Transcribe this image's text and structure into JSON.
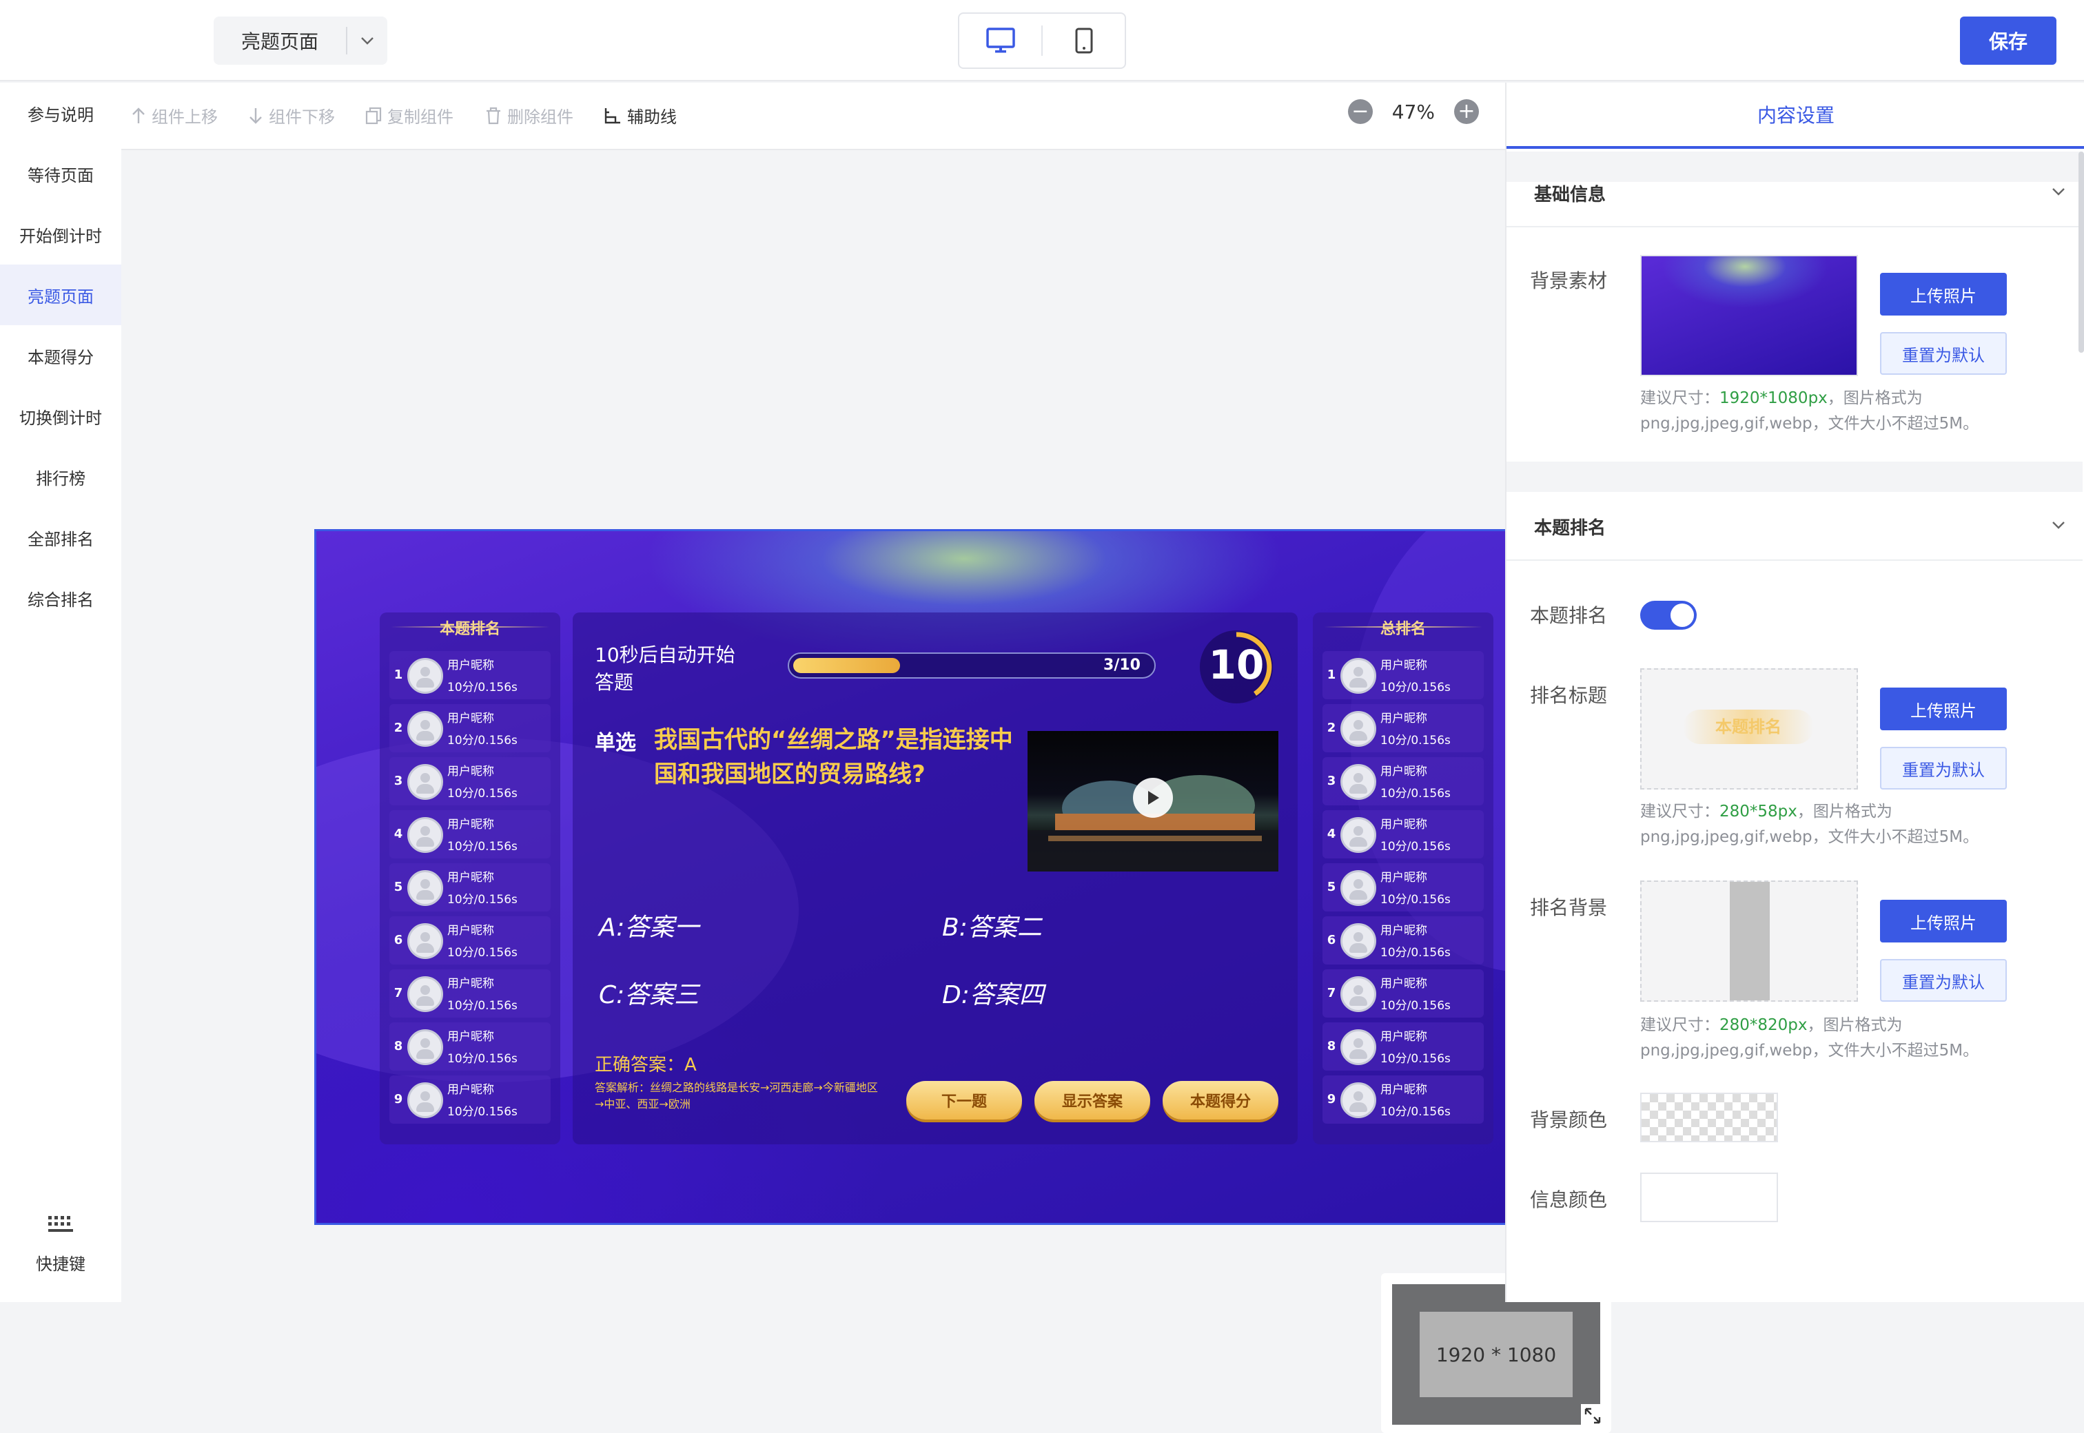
{
  "header": {
    "page_selector": "亮题页面",
    "save_label": "保存"
  },
  "sidebar": {
    "items": [
      {
        "label": "参与说明"
      },
      {
        "label": "等待页面"
      },
      {
        "label": "开始倒计时"
      },
      {
        "label": "亮题页面",
        "active": true
      },
      {
        "label": "本题得分"
      },
      {
        "label": "切换倒计时"
      },
      {
        "label": "排行榜"
      },
      {
        "label": "全部排名"
      },
      {
        "label": "综合排名"
      }
    ],
    "shortcut_label": "快捷键"
  },
  "toolbar": {
    "move_up": "组件上移",
    "move_down": "组件下移",
    "copy": "复制组件",
    "delete": "删除组件",
    "guides": "辅助线",
    "zoom": "47%"
  },
  "stage": {
    "left_rank_title": "本题排名",
    "right_rank_title": "总排名",
    "rank_rows": [
      {
        "num": "1",
        "name": "用户昵称",
        "score": "10分/0.156s"
      },
      {
        "num": "2",
        "name": "用户昵称",
        "score": "10分/0.156s"
      },
      {
        "num": "3",
        "name": "用户昵称",
        "score": "10分/0.156s"
      },
      {
        "num": "4",
        "name": "用户昵称",
        "score": "10分/0.156s"
      },
      {
        "num": "5",
        "name": "用户昵称",
        "score": "10分/0.156s"
      },
      {
        "num": "6",
        "name": "用户昵称",
        "score": "10分/0.156s"
      },
      {
        "num": "7",
        "name": "用户昵称",
        "score": "10分/0.156s"
      },
      {
        "num": "8",
        "name": "用户昵称",
        "score": "10分/0.156s"
      },
      {
        "num": "9",
        "name": "用户昵称",
        "score": "10分/0.156s"
      }
    ],
    "tip": "10秒后自动开始答题",
    "progress_label": "3/10",
    "progress_fraction": 0.3,
    "timer": "10",
    "question_type": "单选",
    "question": "我国古代的“丝绸之路”是指连接中国和我国地区的贸易路线?",
    "options": [
      {
        "text": "A:答案一"
      },
      {
        "text": "B:答案二"
      },
      {
        "text": "C:答案三"
      },
      {
        "text": "D:答案四"
      }
    ],
    "correct_answer": "正确答案：A",
    "answer_detail": "答案解析：丝绸之路的线路是长安→河西走廊→今新疆地区→中亚、西亚→欧洲",
    "buttons": {
      "next": "下一题",
      "show_answer": "显示答案",
      "score": "本题得分"
    }
  },
  "minimap": {
    "label": "1920 * 1080"
  },
  "panel": {
    "tab": "内容设置",
    "section_basic": "基础信息",
    "bg_material_label": "背景素材",
    "upload_label": "上传照片",
    "reset_label": "重置为默认",
    "bg_hint_prefix": "建议尺寸：",
    "bg_hint_size": "1920*1080px",
    "bg_hint_suffix": "，图片格式为png,jpg,jpeg,gif,webp，文件大小不超过5M。",
    "section_rank": "本题排名",
    "rank_toggle_label": "本题排名",
    "rank_toggle_on": true,
    "rank_title_label": "排名标题",
    "rank_title_preview": "本题排名",
    "title_hint_size": "280*58px",
    "title_hint_suffix": "，图片格式为png,jpg,jpeg,gif,webp，文件大小不超过5M。",
    "rank_bg_label": "排名背景",
    "rankbg_hint_size": "280*820px",
    "rankbg_hint_suffix": "，图片格式为png,jpg,jpeg,gif,webp，文件大小不超过5M。",
    "bg_color_label": "背景颜色",
    "info_color_label": "信息颜色"
  },
  "colors": {
    "accent": "#3a59e4",
    "highlight": "#f8cc4d",
    "hint_green": "#2f9e44"
  }
}
